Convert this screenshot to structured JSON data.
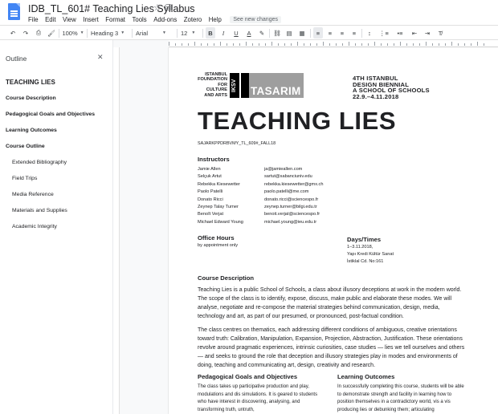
{
  "app": {
    "doc_title": "IDB_TL_601# Teaching Lies Syllabus",
    "menu": [
      "File",
      "Edit",
      "View",
      "Insert",
      "Format",
      "Tools",
      "Add-ons",
      "Zotero",
      "Help"
    ],
    "changes_badge": "See new changes"
  },
  "toolbar": {
    "zoom": "100%",
    "style": "Heading 3",
    "font": "Arial",
    "size": "12",
    "bold": "B",
    "italic": "I",
    "underline": "U",
    "text_color": "A"
  },
  "outline": {
    "header": "Outline",
    "items": [
      {
        "label": "TEACHING LIES",
        "level": 1
      },
      {
        "label": "Course Description",
        "level": 2
      },
      {
        "label": "Pedagogical Goals and Objectives",
        "level": 2
      },
      {
        "label": "Learning Outcomes",
        "level": 2
      },
      {
        "label": "Course Outline",
        "level": 2
      },
      {
        "label": "Extended Bibliography",
        "level": 3
      },
      {
        "label": "Field Trips",
        "level": 3
      },
      {
        "label": "Media Reference",
        "level": 3
      },
      {
        "label": "Materials and Supplies",
        "level": 3
      },
      {
        "label": "Academic Integrity",
        "level": 3
      }
    ]
  },
  "doc": {
    "logo_text": [
      "ISTANBUL",
      "FOUNDATION",
      "FOR",
      "CULTURE",
      "AND ARTS"
    ],
    "logo_iksv": "IKSV",
    "logo_tasarim": "TASARIM",
    "biennial": [
      "4TH ISTANBUL",
      "DESIGN BIENNIAL",
      "A SCHOOL OF SCHOOLS",
      "22.9.–4.11.2018"
    ],
    "title": "TEACHING LIES",
    "code": "SAJARKPPDRBVMY_TL_609#_FALL18",
    "instructors_head": "Instructors",
    "instructors": [
      {
        "name": "Jamie Allen",
        "email": "ja@jamieallen.com"
      },
      {
        "name": "Selçuk Artut",
        "email": "sartut@sabanciuniv.edu"
      },
      {
        "name": "Rebekka Kiesewetter",
        "email": "rebekka.kiesewetter@gmx.ch"
      },
      {
        "name": "Paolo Patelli",
        "email": "paolo.patelli@me.com"
      },
      {
        "name": "Donato Ricci",
        "email": "donato.ricci@sciencespo.fr"
      },
      {
        "name": "Zeynep Talay Turner",
        "email": "zeynep.turner@bilgi.edu.tr"
      },
      {
        "name": "Benoît Verjat",
        "email": "benoit.verjat@sciencespo.fr"
      },
      {
        "name": "Michael Edward Young",
        "email": "michael.young@ieu.edu.tr"
      }
    ],
    "office_head": "Office Hours",
    "office_text": "by appointment only",
    "days_head": "Days/Times",
    "days_lines": [
      "1–3.11.2018,",
      "Yapı Kredi Kültür Sanat",
      "İstiklal Cd. No:161"
    ],
    "desc_head": "Course Description",
    "desc_p1": "Teaching Lies is a public School of Schools, a class about illusory deceptions at work in the modern world. The scope of the class is to identify, expose, discuss, make public and elaborate these modes. We will analyse, negotiate and re-compose the material strategies behind communication, design, media, technology and art, as part of our presumed, or pronounced, post-factual condition.",
    "desc_p2": "The class centres on thematics, each addressing different conditions of ambiguous, creative orientations toward truth: Calibration, Manipulation, Expansion, Projection, Abstraction, Justification. These orientations revolve around pragmatic experiences, intrinsic curiosities, case studies — lies we tell ourselves and others — and seeks to ground the role that deception and illusory strategies play in modes and environments of doing, teaching and communicating art, design, creativity and research.",
    "goals_head": "Pedagogical Goals and Objectives",
    "goals_text": "The class takes up participative production and play, modulations and dis simulations. It is geared to students who have interest in discovering, analysing, and transforming truth, untruth,",
    "outcomes_head": "Learning Outcomes",
    "outcomes_text": "In successfully completing this course, students will be able to demonstrate strength and facility in learning how to position themselves in a contradictory world, vis a vis producing lies or debunking them; articulating"
  }
}
